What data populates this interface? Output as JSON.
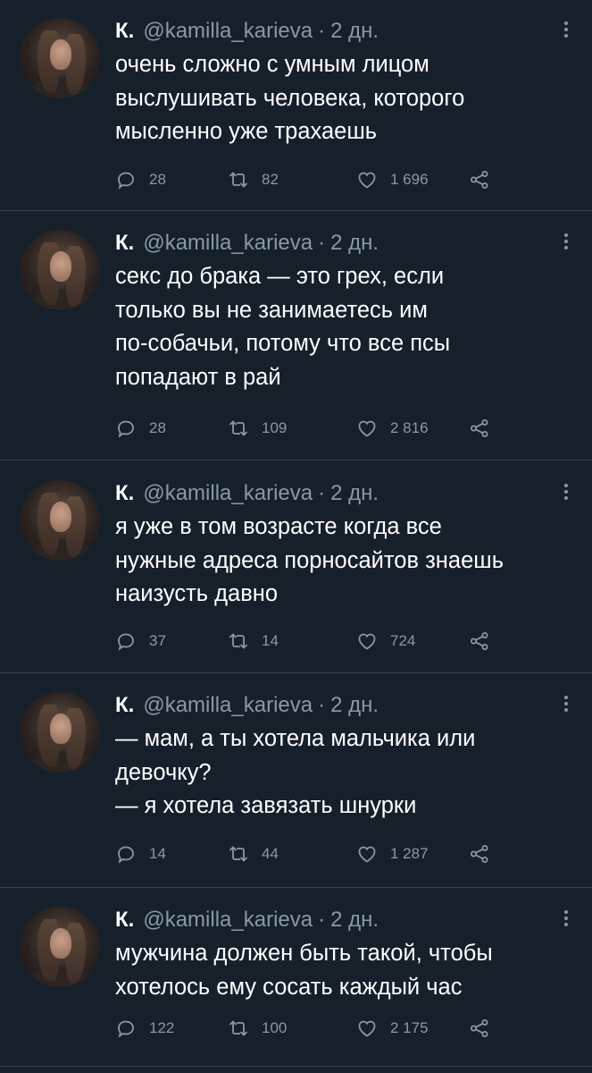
{
  "tweets": [
    {
      "name": "К.",
      "handle": "@kamilla_karieva",
      "dot": "·",
      "time": "2 дн.",
      "lines": [
        "очень сложно с умным лицом",
        "выслушивать человека, которого",
        "мысленно уже трахаешь"
      ],
      "replies": "28",
      "retweets": "82",
      "likes": "1 696"
    },
    {
      "name": "К.",
      "handle": "@kamilla_karieva",
      "dot": "·",
      "time": "2 дн.",
      "lines": [
        "секс до брака — это грех, если",
        "только вы не занимаетесь им",
        "по-собачьи, потому что все псы",
        "попадают в рай"
      ],
      "replies": "28",
      "retweets": "109",
      "likes": "2 816"
    },
    {
      "name": "К.",
      "handle": "@kamilla_karieva",
      "dot": "·",
      "time": "2 дн.",
      "lines": [
        "я уже в том возрасте когда все",
        "нужные адреса порносайтов знаешь",
        "наизусть давно"
      ],
      "replies": "37",
      "retweets": "14",
      "likes": "724"
    },
    {
      "name": "К.",
      "handle": "@kamilla_karieva",
      "dot": "·",
      "time": "2 дн.",
      "lines": [
        "— мам, а ты хотела мальчика или",
        "девочку?",
        "— я хотела завязать шнурки"
      ],
      "replies": "14",
      "retweets": "44",
      "likes": "1 287"
    },
    {
      "name": "К.",
      "handle": "@kamilla_karieva",
      "dot": "·",
      "time": "2 дн.",
      "lines": [
        "мужчина должен быть такой, чтобы",
        "хотелось ему сосать каждый час"
      ],
      "replies": "122",
      "retweets": "100",
      "likes": "2 175"
    }
  ],
  "icons": {
    "reply": "reply-icon",
    "retweet": "retweet-icon",
    "like": "heart-icon",
    "share": "share-icon",
    "more": "more-vertical-icon"
  },
  "colors": {
    "background": "#15202b",
    "text": "#ffffff",
    "muted": "#8899a6",
    "divider": "#38444d"
  }
}
